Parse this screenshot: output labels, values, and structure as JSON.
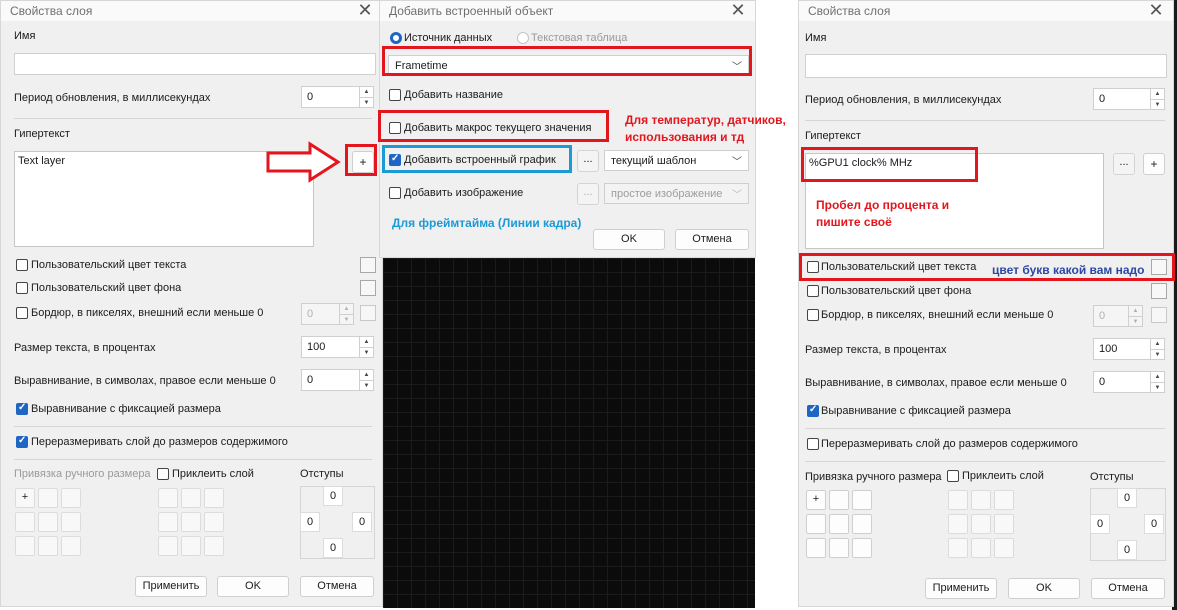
{
  "left": {
    "title": "Свойства слоя",
    "close": "✕",
    "name_label": "Имя",
    "period_label": "Период обновления, в миллисекундах",
    "period_value": "0",
    "hypertext_label": "Гипертекст",
    "hypertext_value": "Text layer",
    "plus": "+",
    "custom_text_color": "Пользовательский цвет текста",
    "custom_bg_color": "Пользовательский цвет фона",
    "border_label": "Бордюр, в пикселях, внешний если меньше 0",
    "border_value": "0",
    "text_size_label": "Размер текста, в процентах",
    "text_size_value": "100",
    "align_label": "Выравнивание, в символах, правое если меньше 0",
    "align_value": "0",
    "fixed_align": "Выравнивание с фиксацией размера",
    "resize_layer": "Переразмеривать слой до размеров содержимого",
    "manual_anchor": "Привязка ручного размера",
    "stick_layer": "Приклеить слой",
    "offsets_label": "Отступы",
    "offset_top": "0",
    "offset_left": "0",
    "offset_right": "0",
    "offset_bottom": "0",
    "apply": "Применить",
    "ok": "OK",
    "cancel": "Отмена"
  },
  "middle": {
    "title": "Добавить встроенный объект",
    "close": "✕",
    "radio_source": "Источник данных",
    "radio_table": "Текстовая таблица",
    "source_value": "Frametime",
    "add_name": "Добавить название",
    "add_macro": "Добавить макрос текущего значения",
    "add_graph": "Добавить встроенный график",
    "dots": "...",
    "graph_template": "текущий шаблон",
    "add_image": "Добавить изображение",
    "image_template": "простое изображение",
    "ok": "OK",
    "cancel": "Отмена"
  },
  "annotations": {
    "temps_line1": "Для температур, датчиков,",
    "temps_line2": "использования и тд",
    "frametime": "Для фреймтайма (Линии кадра)",
    "space_line1": "Пробел до процента и",
    "space_line2": "пишите своё",
    "letter_color": "цвет букв какой вам надо"
  },
  "right": {
    "title": "Свойства слоя",
    "close": "✕",
    "name_label": "Имя",
    "period_label": "Период обновления, в миллисекундах",
    "period_value": "0",
    "hypertext_label": "Гипертекст",
    "hypertext_value": "%GPU1 clock% MHz",
    "dots": "...",
    "plus": "+",
    "custom_text_color": "Пользовательский цвет текста",
    "custom_bg_color": "Пользовательский цвет фона",
    "border_label": "Бордюр, в пикселях, внешний если меньше 0",
    "border_value": "0",
    "text_size_label": "Размер текста, в процентах",
    "text_size_value": "100",
    "align_label": "Выравнивание, в символах, правое если меньше 0",
    "align_value": "0",
    "fixed_align": "Выравнивание с фиксацией размера",
    "resize_layer": "Переразмеривать слой до размеров содержимого",
    "manual_anchor": "Привязка ручного размера",
    "stick_layer": "Приклеить слой",
    "offsets_label": "Отступы",
    "offset_top": "0",
    "offset_left": "0",
    "offset_right": "0",
    "offset_bottom": "0",
    "apply": "Применить",
    "ok": "OK",
    "cancel": "Отмена"
  },
  "colors": {
    "annotation_red": "#e3161e",
    "annotation_blue": "#1c9ad6",
    "annotation_navy": "#2b48a6",
    "checkbox_accent": "#1f65c4"
  }
}
